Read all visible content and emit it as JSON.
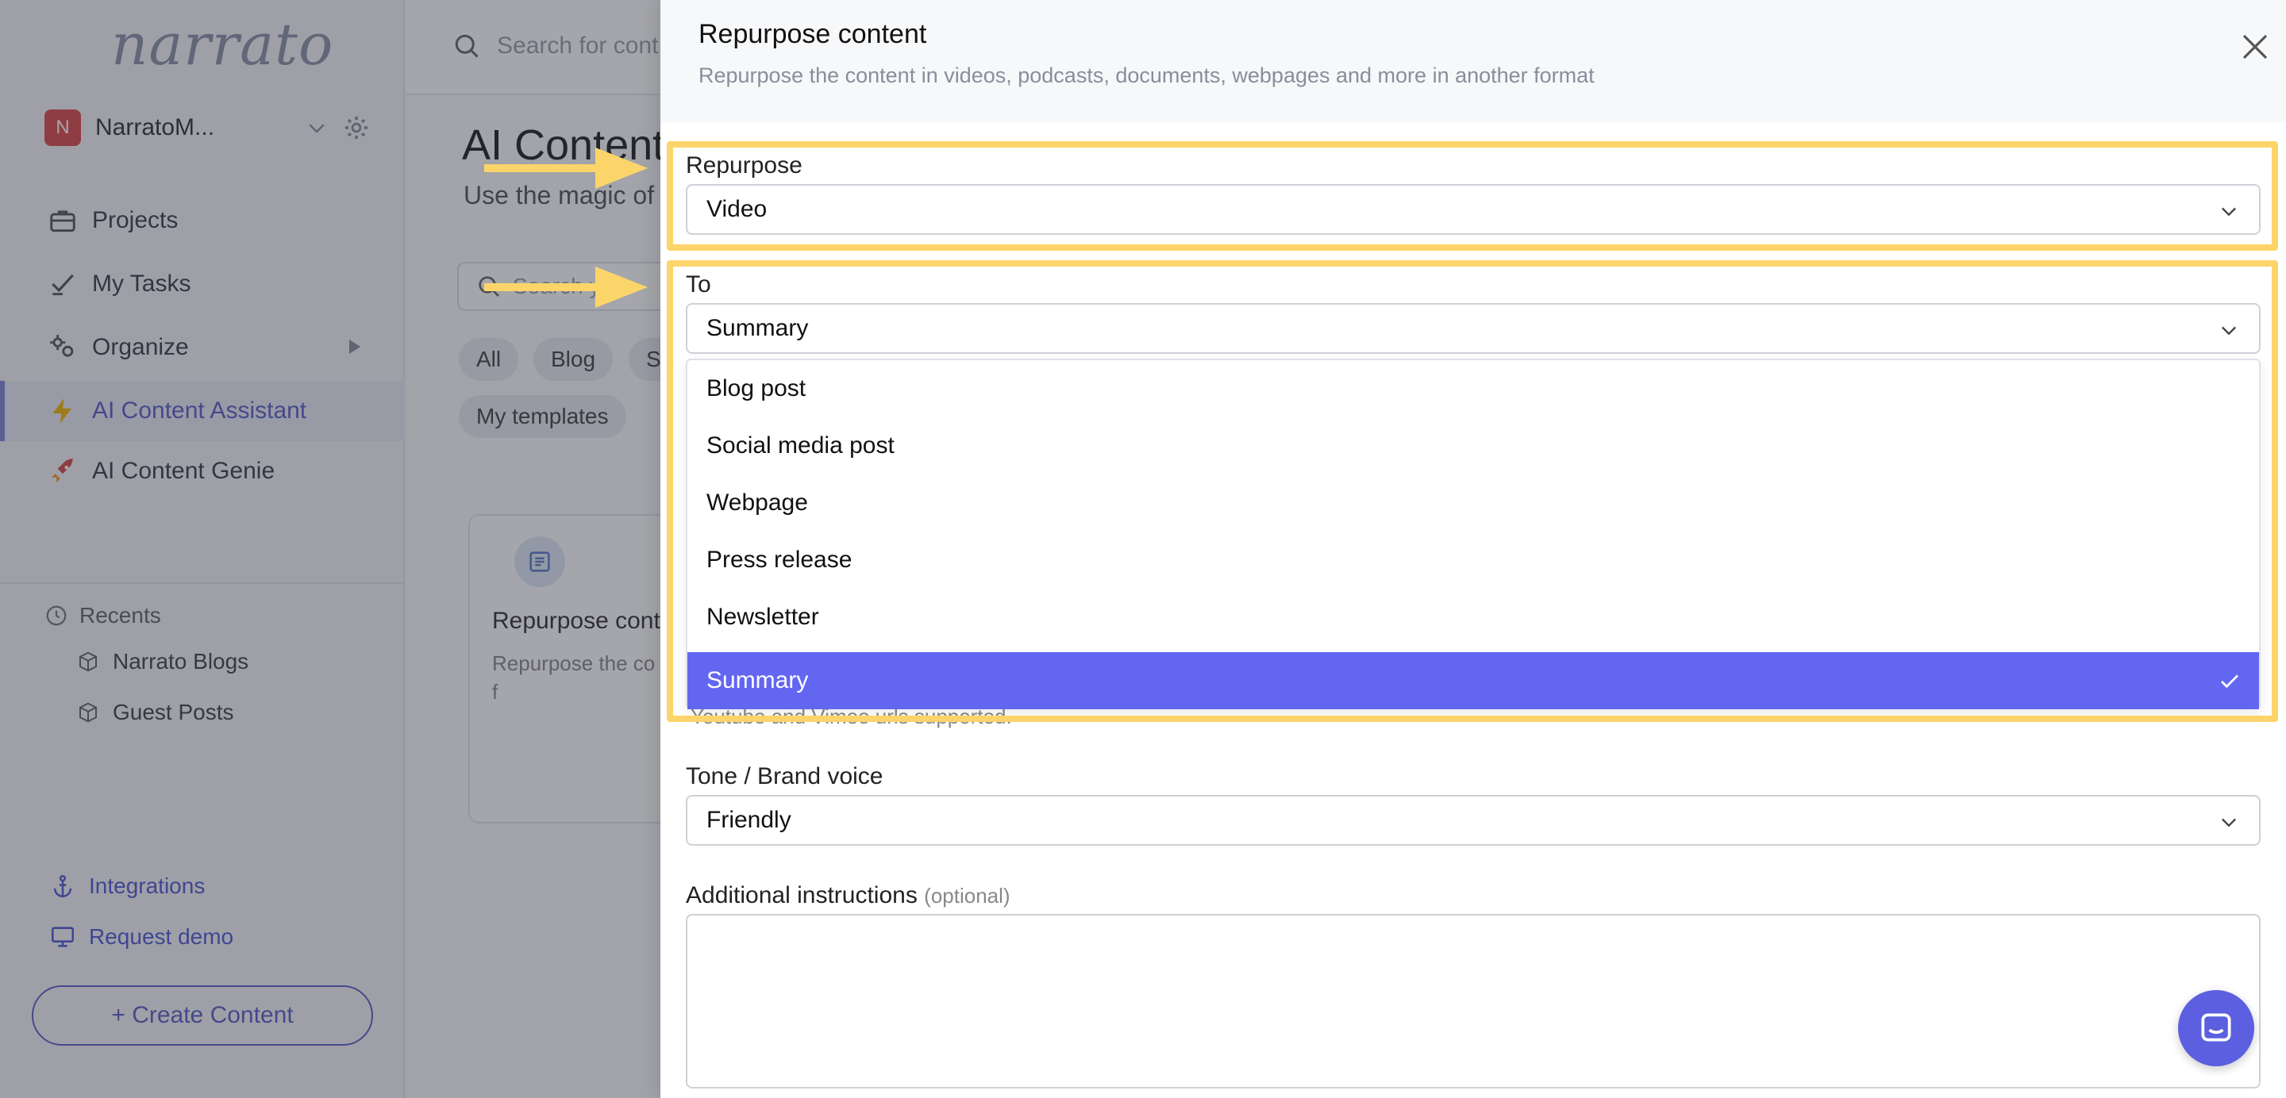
{
  "sidebar": {
    "logo": "narrato",
    "workspace": {
      "initial": "N",
      "name": "NarratoM..."
    },
    "nav": [
      {
        "label": "Projects"
      },
      {
        "label": "My Tasks"
      },
      {
        "label": "Organize"
      },
      {
        "label": "AI Content Assistant"
      },
      {
        "label": "AI Content Genie"
      }
    ],
    "recents_title": "Recents",
    "recents": [
      {
        "label": "Narrato Blogs"
      },
      {
        "label": "Guest Posts"
      }
    ],
    "links": [
      {
        "label": "Integrations"
      },
      {
        "label": "Request demo"
      }
    ],
    "create_button": "+ Create Content"
  },
  "main": {
    "search_placeholder": "Search for cont",
    "title": "AI Content",
    "subtitle": "Use the magic of",
    "template_search_placeholder": "Search yo",
    "chips": [
      "All",
      "Blog",
      "S",
      "My templates"
    ],
    "card": {
      "title": "Repurpose cont",
      "description": "Repurpose the co podcasts, docum more in another f"
    }
  },
  "modal": {
    "title": "Repurpose content",
    "subtitle": "Repurpose the content in videos, podcasts, documents, webpages and more in another format",
    "repurpose_label": "Repurpose",
    "repurpose_value": "Video",
    "to_label": "To",
    "to_value": "Summary",
    "options": [
      "Blog post",
      "Social media post",
      "Webpage",
      "Press release",
      "Newsletter",
      "Summary"
    ],
    "selected_option": "Summary",
    "helper_text": "Youtube and Vimeo urls supported.",
    "tone_label": "Tone / Brand voice",
    "tone_value": "Friendly",
    "instructions_label": "Additional instructions",
    "instructions_optional": "(optional)",
    "instructions_value": ""
  },
  "colors": {
    "accent": "#6366f1",
    "highlight": "#fcd56a",
    "brand_link": "#4f5bd5",
    "workspace_avatar": "#d94a4a"
  }
}
